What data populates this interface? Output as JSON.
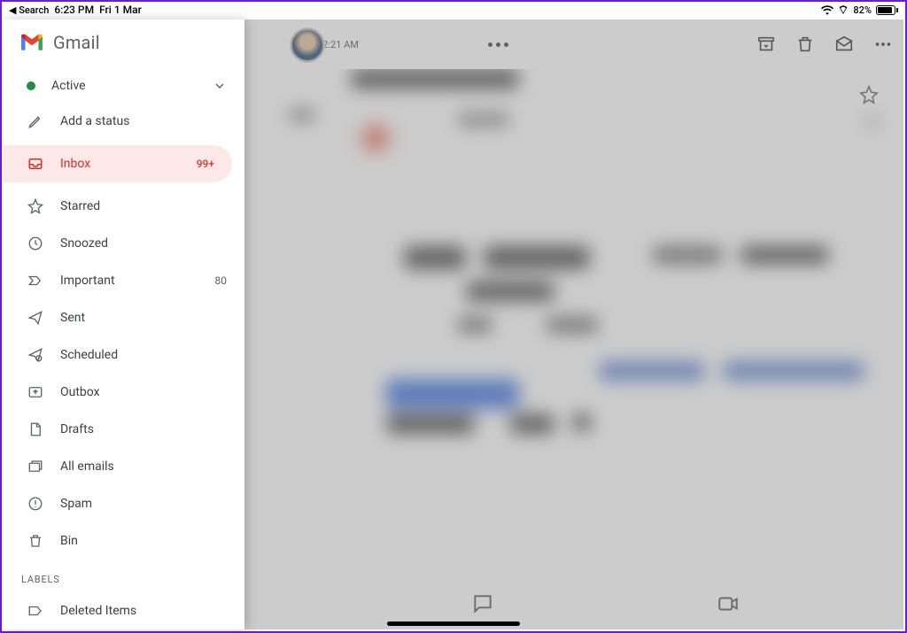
{
  "statusbar": {
    "back": "Search",
    "time": "6:23 PM",
    "date": "Fri 1 Mar",
    "battery_pct": "82%"
  },
  "under": {
    "time": "12:21 AM"
  },
  "sidebar": {
    "title": "Gmail",
    "status": {
      "active": "Active",
      "add": "Add a status"
    },
    "nav": {
      "inbox": {
        "label": "Inbox",
        "count": "99+"
      },
      "starred": {
        "label": "Starred"
      },
      "snoozed": {
        "label": "Snoozed"
      },
      "important": {
        "label": "Important",
        "count": "80"
      },
      "sent": {
        "label": "Sent"
      },
      "scheduled": {
        "label": "Scheduled"
      },
      "outbox": {
        "label": "Outbox"
      },
      "drafts": {
        "label": "Drafts"
      },
      "all": {
        "label": "All emails"
      },
      "spam": {
        "label": "Spam"
      },
      "bin": {
        "label": "Bin"
      }
    },
    "labels_header": "LABELS",
    "labels": {
      "deleted": "Deleted Items"
    }
  }
}
